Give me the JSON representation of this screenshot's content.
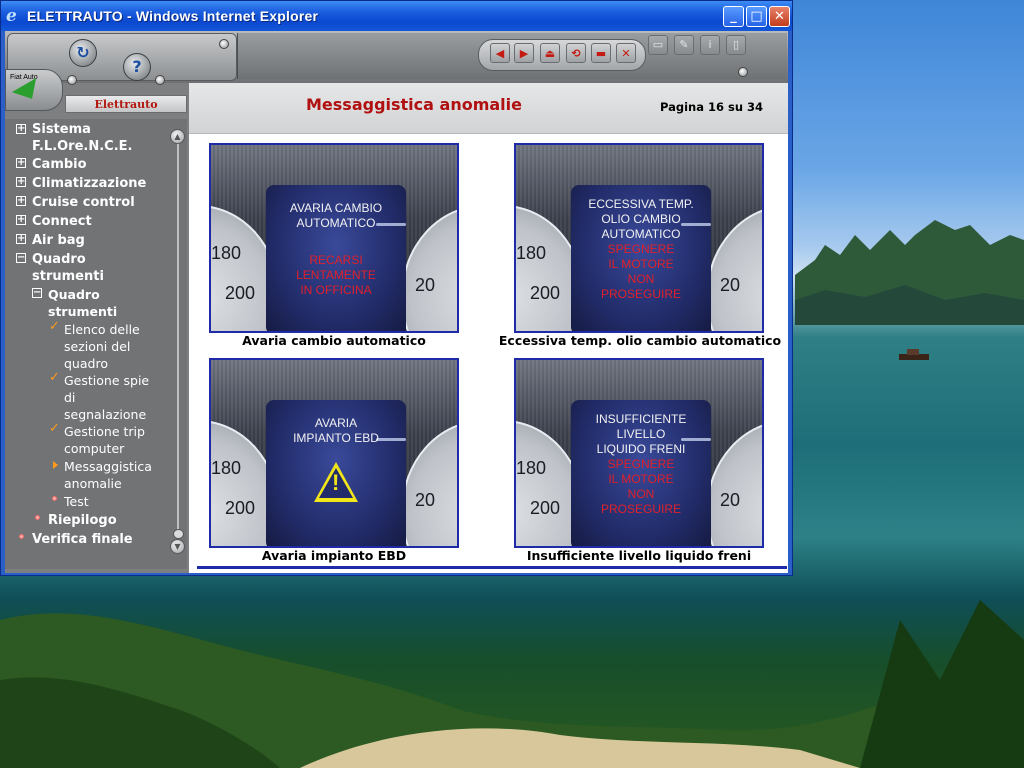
{
  "window": {
    "title": "ELETTRAUTO - Windows Internet Explorer"
  },
  "header": {
    "brand": "Fiat Auto",
    "app_label": "Elettrauto",
    "help_glyph": "?"
  },
  "sidebar": {
    "items": [
      {
        "label": "Sistema",
        "label2": "F.L.Ore.N.C.E.",
        "icon": "plus-box-icon"
      },
      {
        "label": "Cambio",
        "icon": "plus-box-icon"
      },
      {
        "label": "Climatizzazione",
        "icon": "plus-box-icon"
      },
      {
        "label": "Cruise control",
        "icon": "plus-box-icon"
      },
      {
        "label": "Connect",
        "icon": "plus-box-icon"
      },
      {
        "label": "Air bag",
        "icon": "plus-box-icon"
      },
      {
        "label": "Quadro",
        "label2": "strumenti",
        "icon": "minus-box-icon"
      },
      {
        "label": "Quadro",
        "label2": "strumenti",
        "icon": "minus-box-icon"
      },
      {
        "label": "Elenco delle",
        "label2": "sezioni del",
        "label3": "quadro",
        "icon": "check-icon"
      },
      {
        "label": "Gestione spie",
        "label2": "di",
        "label3": "segnalazione",
        "icon": "check-icon"
      },
      {
        "label": "Gestione trip",
        "label2": "computer",
        "icon": "check-icon"
      },
      {
        "label": "Messaggistica",
        "label2": "anomalie",
        "icon": "arrow-right-icon"
      },
      {
        "label": "Test",
        "icon": "dot-icon"
      },
      {
        "label": "Riepilogo",
        "icon": "dot-icon"
      },
      {
        "label": "Verifica finale",
        "icon": "dot-icon"
      }
    ]
  },
  "content": {
    "title": "Messaggistica anomalie",
    "page": "Pagina 16 su 34",
    "cards": [
      {
        "caption": "Avaria cambio automatico",
        "white_lines": [
          "AVARIA CAMBIO",
          "AUTOMATICO"
        ],
        "red_lines": [
          "RECARSI",
          "LENTAMENTE",
          "IN OFFICINA"
        ],
        "dial_left_top": "180",
        "dial_left_bottom": "200",
        "dial_right": "20"
      },
      {
        "caption": "Eccessiva temp. olio cambio automatico",
        "white_lines": [
          "ECCESSIVA TEMP.",
          "OLIO CAMBIO",
          "AUTOMATICO"
        ],
        "red_lines": [
          "SPEGNERE",
          "IL MOTORE",
          "NON",
          "PROSEGUIRE"
        ],
        "dial_left_top": "180",
        "dial_left_bottom": "200",
        "dial_right": "20"
      },
      {
        "caption": "Avaria impianto EBD",
        "white_lines": [
          "AVARIA",
          "IMPIANTO EBD"
        ],
        "red_lines": [],
        "warning_glyph": "!",
        "dial_left_top": "180",
        "dial_left_bottom": "200",
        "dial_right": "20"
      },
      {
        "caption": "Insufficiente livello liquido freni",
        "white_lines": [
          "INSUFFICIENTE",
          "LIVELLO",
          "LIQUIDO FRENI"
        ],
        "red_lines": [
          "SPEGNERE",
          "IL MOTORE",
          "NON",
          "PROSEGUIRE"
        ],
        "dial_left_top": "180",
        "dial_left_bottom": "200",
        "dial_right": "20"
      }
    ]
  },
  "colors": {
    "title_red": "#b01010",
    "card_border": "#1e2aa8",
    "check_orange": "#ff9a1a"
  }
}
